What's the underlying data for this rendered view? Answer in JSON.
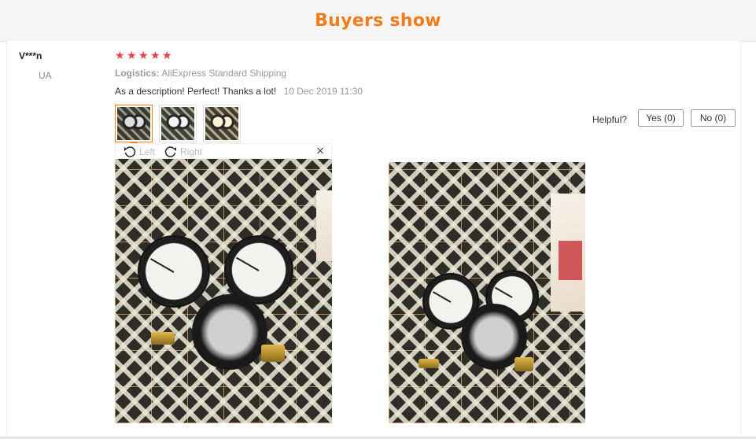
{
  "banner": {
    "title": "Buyers show"
  },
  "review": {
    "user_name": "V***n",
    "country": "UA",
    "rating": 5,
    "stars": [
      "★",
      "★",
      "★",
      "★",
      "★"
    ],
    "logistics_label": "Logistics:",
    "logistics_value": "AliExpress Standard Shipping",
    "text": "As a description! Perfect! Thanks a lot!",
    "date": "10 Dec 2019 11:30",
    "thumbnails": [
      "photo-1",
      "photo-2",
      "photo-3"
    ],
    "helpful_label": "Helpful?",
    "yes_label": "Yes (0)",
    "no_label": "No (0)"
  },
  "viewer": {
    "rotate_left_label": "Left",
    "rotate_right_label": "Right",
    "close_symbol": "×"
  },
  "colors": {
    "accent": "#f07d1a",
    "star": "#e8404c"
  }
}
